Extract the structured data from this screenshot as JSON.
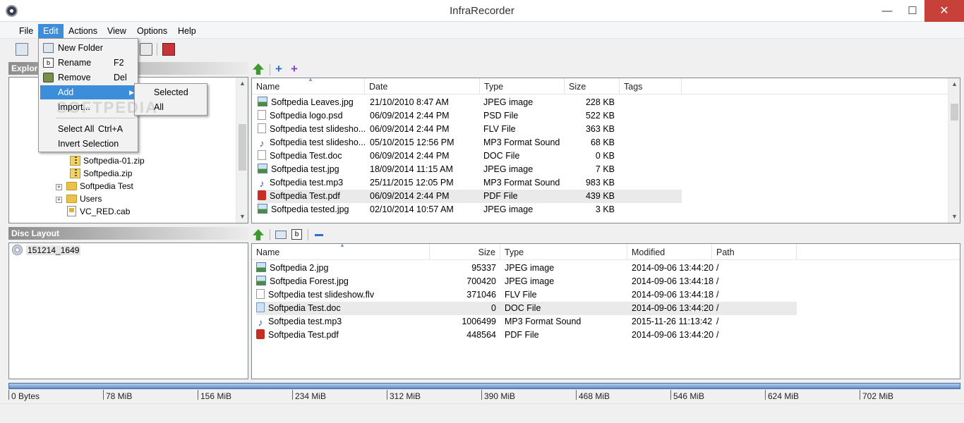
{
  "window": {
    "title": "InfraRecorder",
    "minimize": "—",
    "maximize": "☐",
    "close": "✕"
  },
  "menubar": [
    "File",
    "Edit",
    "Actions",
    "View",
    "Options",
    "Help"
  ],
  "edit_menu": {
    "items": [
      {
        "label": "New Folder",
        "shortcut": "",
        "icon": "new-folder-icon"
      },
      {
        "label": "Rename",
        "shortcut": "F2",
        "icon": "rename-icon"
      },
      {
        "label": "Remove",
        "shortcut": "Del",
        "icon": "remove-icon"
      },
      {
        "label": "Add",
        "shortcut": "",
        "icon": "",
        "submenu": true
      },
      {
        "label": "Import...",
        "shortcut": "",
        "icon": ""
      },
      {
        "label": "Select All",
        "shortcut": "Ctrl+A",
        "icon": ""
      },
      {
        "label": "Invert Selection",
        "shortcut": "",
        "icon": ""
      }
    ],
    "add_submenu": [
      "Selected",
      "All"
    ]
  },
  "watermark": "SOFTPEDIA",
  "explorer": {
    "header": "Explorer",
    "tree": [
      {
        "label": "Softpedia-01.zip",
        "type": "zip"
      },
      {
        "label": "Softpedia.zip",
        "type": "zip"
      },
      {
        "label": "Softpedia Test",
        "type": "folder",
        "expander": "+"
      },
      {
        "label": "Users",
        "type": "folder",
        "expander": "+"
      },
      {
        "label": "VC_RED.cab",
        "type": "cab"
      }
    ]
  },
  "file_list": {
    "columns": [
      "Name",
      "Date",
      "Type",
      "Size",
      "Tags"
    ],
    "rows": [
      {
        "name": "Softpedia Leaves.jpg",
        "date": "21/10/2010 8:47 AM",
        "type": "JPEG image",
        "size": "228 KB",
        "icon": "jpeg"
      },
      {
        "name": "Softpedia logo.psd",
        "date": "06/09/2014 2:44 PM",
        "type": "PSD File",
        "size": "522 KB",
        "icon": "doc"
      },
      {
        "name": "Softpedia test slidesho...",
        "date": "06/09/2014 2:44 PM",
        "type": "FLV File",
        "size": "363 KB",
        "icon": "doc"
      },
      {
        "name": "Softpedia test slidesho...",
        "date": "05/10/2015 12:56 PM",
        "type": "MP3 Format Sound",
        "size": "68 KB",
        "icon": "mp3"
      },
      {
        "name": "Softpedia Test.doc",
        "date": "06/09/2014 2:44 PM",
        "type": "DOC File",
        "size": "0 KB",
        "icon": "doc"
      },
      {
        "name": "Softpedia test.jpg",
        "date": "18/09/2014 11:15 AM",
        "type": "JPEG image",
        "size": "7 KB",
        "icon": "jpeg"
      },
      {
        "name": "Softpedia test.mp3",
        "date": "25/11/2015 12:05 PM",
        "type": "MP3 Format Sound",
        "size": "983 KB",
        "icon": "mp3"
      },
      {
        "name": "Softpedia Test.pdf",
        "date": "06/09/2014 2:44 PM",
        "type": "PDF File",
        "size": "439 KB",
        "icon": "pdf"
      },
      {
        "name": "Softpedia tested.jpg",
        "date": "02/10/2014 10:57 AM",
        "type": "JPEG image",
        "size": "3 KB",
        "icon": "jpeg"
      }
    ],
    "hover_row": 7
  },
  "disc_layout": {
    "header": "Disc Layout",
    "root": "151214_1649",
    "columns": [
      "Name",
      "Size",
      "Type",
      "Modified",
      "Path"
    ],
    "rows": [
      {
        "name": "Softpedia 2.jpg",
        "size": "95337",
        "type": "JPEG image",
        "modified": "2014-09-06 13:44:20",
        "path": "/",
        "icon": "jpeg"
      },
      {
        "name": "Softpedia Forest.jpg",
        "size": "700420",
        "type": "JPEG image",
        "modified": "2014-09-06 13:44:18",
        "path": "/",
        "icon": "jpeg"
      },
      {
        "name": "Softpedia test slideshow.flv",
        "size": "371046",
        "type": "FLV File",
        "modified": "2014-09-06 13:44:18",
        "path": "/",
        "icon": "doc"
      },
      {
        "name": "Softpedia Test.doc",
        "size": "0",
        "type": "DOC File",
        "modified": "2014-09-06 13:44:20",
        "path": "/",
        "icon": "docsel"
      },
      {
        "name": "Softpedia test.mp3",
        "size": "1006499",
        "type": "MP3 Format Sound",
        "modified": "2015-11-26 11:13:42",
        "path": "/",
        "icon": "mp3"
      },
      {
        "name": "Softpedia Test.pdf",
        "size": "448564",
        "type": "PDF File",
        "modified": "2014-09-06 13:44:20",
        "path": "/",
        "icon": "pdf"
      }
    ],
    "selected_row": 3
  },
  "disc_scale": [
    "0 Bytes",
    "78 MiB",
    "156 MiB",
    "234 MiB",
    "312 MiB",
    "390 MiB",
    "468 MiB",
    "546 MiB",
    "624 MiB",
    "702 MiB"
  ],
  "colors": {
    "accent": "#3c8edb",
    "close": "#c7403a",
    "meter": "#5f8fcb",
    "folder": "#eac04f"
  }
}
